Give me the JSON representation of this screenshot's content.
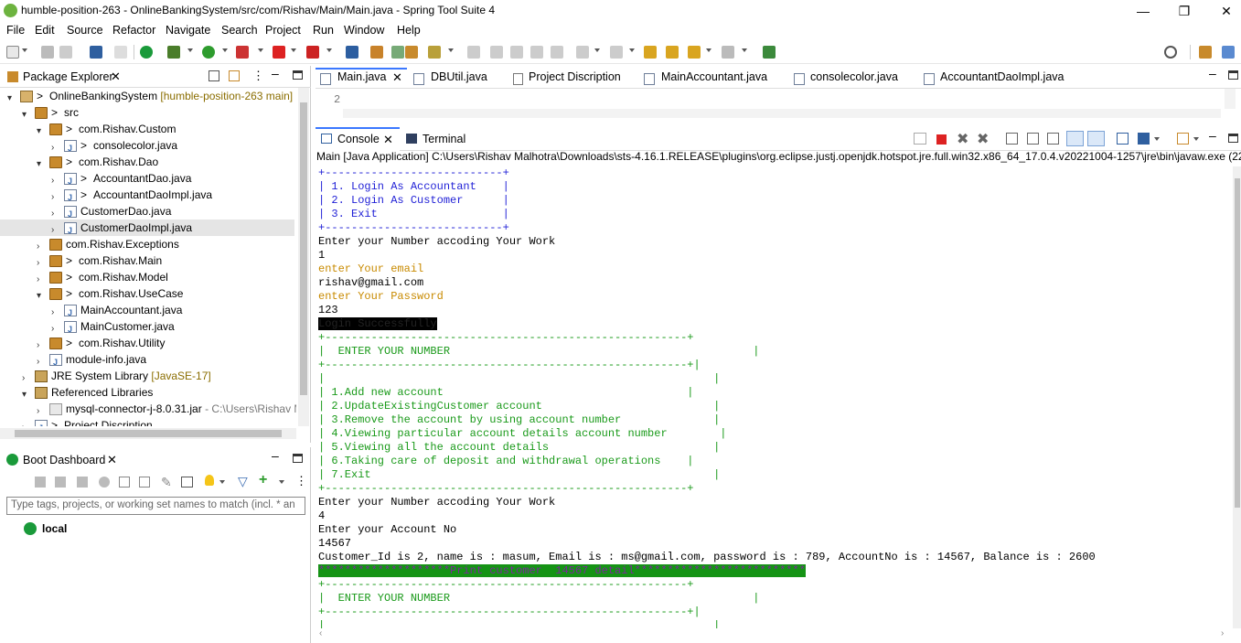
{
  "window": {
    "title": "humble-position-263 - OnlineBankingSystem/src/com/Rishav/Main/Main.java - Spring Tool Suite 4",
    "minimize": "—",
    "restore": "❐",
    "close": "✕"
  },
  "menu": [
    "File",
    "Edit",
    "Source",
    "Refactor",
    "Navigate",
    "Search",
    "Project",
    "Run",
    "Window",
    "Help"
  ],
  "package_explorer": {
    "title": "Package Explorer",
    "tree": [
      {
        "level": 0,
        "twisty": "▾",
        "icon": "project",
        "prefix": "> ",
        "label": "OnlineBankingSystem",
        "decoration": " [humble-position-263 main]"
      },
      {
        "level": 1,
        "twisty": "▾",
        "icon": "src-folder",
        "prefix": "> ",
        "label": "src",
        "decoration": ""
      },
      {
        "level": 2,
        "twisty": "▾",
        "icon": "package",
        "prefix": "> ",
        "label": "com.Rishav.Custom",
        "decoration": ""
      },
      {
        "level": 3,
        "twisty": "›",
        "icon": "java",
        "prefix": "> ",
        "label": "consolecolor.java",
        "decoration": ""
      },
      {
        "level": 2,
        "twisty": "▾",
        "icon": "package",
        "prefix": "> ",
        "label": "com.Rishav.Dao",
        "decoration": ""
      },
      {
        "level": 3,
        "twisty": "›",
        "icon": "java",
        "prefix": "> ",
        "label": "AccountantDao.java",
        "decoration": ""
      },
      {
        "level": 3,
        "twisty": "›",
        "icon": "java",
        "prefix": "> ",
        "label": "AccountantDaoImpl.java",
        "decoration": ""
      },
      {
        "level": 3,
        "twisty": "›",
        "icon": "java",
        "prefix": "",
        "label": "CustomerDao.java",
        "decoration": ""
      },
      {
        "level": 3,
        "twisty": "›",
        "icon": "java",
        "prefix": "",
        "label": "CustomerDaoImpl.java",
        "decoration": "",
        "selected": true
      },
      {
        "level": 2,
        "twisty": "›",
        "icon": "package",
        "prefix": "",
        "label": "com.Rishav.Exceptions",
        "decoration": ""
      },
      {
        "level": 2,
        "twisty": "›",
        "icon": "package",
        "prefix": "> ",
        "label": "com.Rishav.Main",
        "decoration": ""
      },
      {
        "level": 2,
        "twisty": "›",
        "icon": "package",
        "prefix": "> ",
        "label": "com.Rishav.Model",
        "decoration": ""
      },
      {
        "level": 2,
        "twisty": "▾",
        "icon": "package",
        "prefix": "> ",
        "label": "com.Rishav.UseCase",
        "decoration": ""
      },
      {
        "level": 3,
        "twisty": "›",
        "icon": "java",
        "prefix": "",
        "label": "MainAccountant.java",
        "decoration": ""
      },
      {
        "level": 3,
        "twisty": "›",
        "icon": "java",
        "prefix": "",
        "label": "MainCustomer.java",
        "decoration": ""
      },
      {
        "level": 2,
        "twisty": "›",
        "icon": "package",
        "prefix": "> ",
        "label": "com.Rishav.Utility",
        "decoration": ""
      },
      {
        "level": 2,
        "twisty": "›",
        "icon": "java",
        "prefix": "",
        "label": "module-info.java",
        "decoration": ""
      },
      {
        "level": 1,
        "twisty": "›",
        "icon": "library",
        "prefix": "",
        "label": "JRE System Library",
        "decoration": " [JavaSE-17]"
      },
      {
        "level": 1,
        "twisty": "▾",
        "icon": "library",
        "prefix": "",
        "label": "Referenced Libraries",
        "decoration": ""
      },
      {
        "level": 2,
        "twisty": "›",
        "icon": "jar",
        "prefix": "",
        "label": "mysql-connector-j-8.0.31.jar",
        "decoration": " - C:\\Users\\Rishav M"
      },
      {
        "level": 1,
        "twisty": "›",
        "icon": "file",
        "prefix": "> ",
        "label": "Project Discription",
        "decoration": ""
      }
    ]
  },
  "boot_dashboard": {
    "title": "Boot Dashboard",
    "filter_placeholder": "Type tags, projects, or working set names to match (incl. * an",
    "local_label": "local"
  },
  "editor": {
    "tabs": [
      "Main.java",
      "DBUtil.java",
      "Project Discription",
      "MainAccountant.java",
      "consolecolor.java",
      "AccountantDaoImpl.java"
    ],
    "line_number": "2"
  },
  "console": {
    "tab_console": "Console",
    "tab_terminal": "Terminal",
    "launch": "Main [Java Application] C:\\Users\\Rishav Malhotra\\Downloads\\sts-4.16.1.RELEASE\\plugins\\org.eclipse.justj.openjdk.hotspot.jre.full.win32.x86_64_17.0.4.v20221004-1257\\jre\\bin\\javaw.exe  (22-Ja",
    "lines": [
      {
        "t": "+---------------------------+",
        "c": "blue"
      },
      {
        "t": "| 1. Login As Accountant    |",
        "c": "blue"
      },
      {
        "t": "| 2. Login As Customer      |",
        "c": "blue"
      },
      {
        "t": "| 3. Exit                   |",
        "c": "blue"
      },
      {
        "t": "+---------------------------+",
        "c": "blue"
      },
      {
        "t": "Enter your Number accoding Your Work",
        "c": ""
      },
      {
        "t": "1",
        "c": ""
      },
      {
        "t": "enter Your email",
        "c": "gold"
      },
      {
        "t": "rishav@gmail.com",
        "c": ""
      },
      {
        "t": "enter Your Password",
        "c": "gold"
      },
      {
        "t": "123",
        "c": ""
      },
      {
        "t": "Login Successfully",
        "c": "blk"
      },
      {
        "t": "+-------------------------------------------------------+",
        "c": "green"
      },
      {
        "t": "|  ENTER YOUR NUMBER                                              |",
        "c": "green"
      },
      {
        "t": "+-------------------------------------------------------+|",
        "c": "green"
      },
      {
        "t": "|                                                           |",
        "c": "green"
      },
      {
        "t": "| 1.Add new account                                     |",
        "c": "green"
      },
      {
        "t": "| 2.UpdateExistingCustomer account                          |",
        "c": "green"
      },
      {
        "t": "| 3.Remove the account by using account number              |",
        "c": "green"
      },
      {
        "t": "| 4.Viewing particular account details account number        |",
        "c": "green"
      },
      {
        "t": "| 5.Viewing all the account details                         |",
        "c": "green"
      },
      {
        "t": "| 6.Taking care of deposit and withdrawal operations    |",
        "c": "green"
      },
      {
        "t": "| 7.Exit                                                    |",
        "c": "green"
      },
      {
        "t": "+-------------------------------------------------------+",
        "c": "green"
      },
      {
        "t": "Enter your Number accoding Your Work",
        "c": ""
      },
      {
        "t": "4",
        "c": ""
      },
      {
        "t": "Enter your Account No",
        "c": ""
      },
      {
        "t": "14567",
        "c": ""
      },
      {
        "t": "Customer_Id is 2, name is : masum, Email is : ms@gmail.com, password is : 789, AccountNo is : 14567, Balance is : 2600",
        "c": ""
      },
      {
        "t": "********************Print customer  14567 detail**************************",
        "c": "greenbg"
      },
      {
        "t": "+-------------------------------------------------------+",
        "c": "green"
      },
      {
        "t": "|  ENTER YOUR NUMBER                                              |",
        "c": "green"
      },
      {
        "t": "+-------------------------------------------------------+|",
        "c": "green"
      },
      {
        "t": "|                                                           |",
        "c": "green"
      }
    ]
  }
}
